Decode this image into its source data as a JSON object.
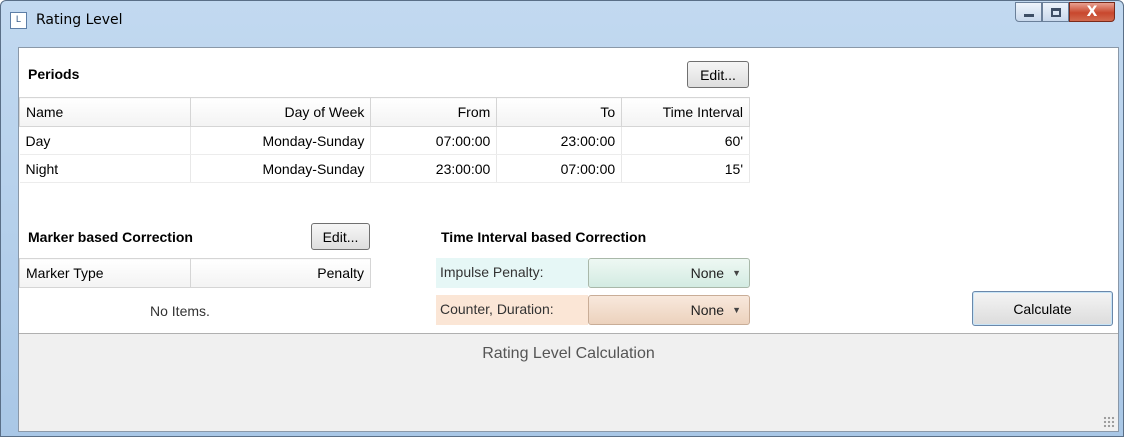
{
  "window": {
    "title": "Rating Level",
    "icon": "window-app-icon",
    "close_label": "X"
  },
  "periods": {
    "title": "Periods",
    "edit_label": "Edit...",
    "columns": [
      "Name",
      "Day of Week",
      "From",
      "To",
      "Time Interval"
    ],
    "rows": [
      {
        "name": "Day",
        "day_of_week": "Monday-Sunday",
        "from": "07:00:00",
        "to": "23:00:00",
        "interval": "60'"
      },
      {
        "name": "Night",
        "day_of_week": "Monday-Sunday",
        "from": "23:00:00",
        "to": "07:00:00",
        "interval": "15'"
      }
    ]
  },
  "marker_correction": {
    "title": "Marker based Correction",
    "edit_label": "Edit...",
    "columns": [
      "Marker Type",
      "Penalty"
    ],
    "empty_text": "No Items."
  },
  "interval_correction": {
    "title": "Time Interval based Correction",
    "impulse_label": "Impulse Penalty:",
    "impulse_value": "None",
    "counter_label": "Counter, Duration:",
    "counter_value": "None",
    "impulse_color": "#e6f7f6",
    "counter_color": "#fbe6d6"
  },
  "actions": {
    "calculate_label": "Calculate"
  },
  "result_panel": {
    "caption": "Rating Level Calculation"
  }
}
